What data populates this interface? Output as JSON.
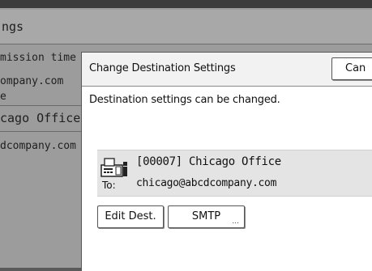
{
  "background": {
    "title": "ngs",
    "rows": [
      "mission time c",
      "ompany.com",
      "e",
      "cago Office",
      "dcompany.com"
    ]
  },
  "dialog": {
    "title": "Change Destination Settings",
    "cancel_label": "Can",
    "message": "Destination settings can be changed.",
    "destination": {
      "icon": "fax-icon",
      "name": "[00007] Chicago Office",
      "to_label": "To:",
      "email": "chicago@abcdcompany.com"
    },
    "buttons": {
      "edit_label": "Edit Dest.",
      "smtp_label": "SMTP",
      "smtp_suffix": "..."
    }
  }
}
